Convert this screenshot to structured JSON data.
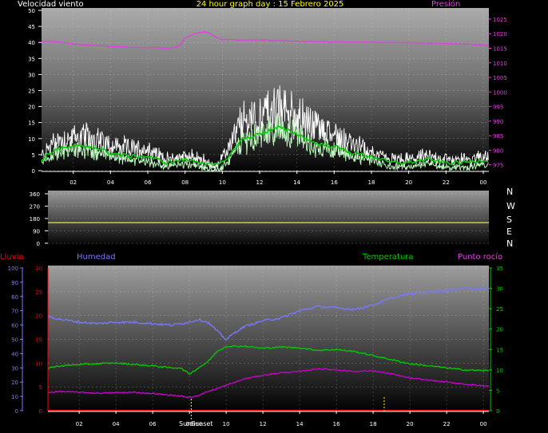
{
  "header": {
    "wind_label": "Velocidad viento",
    "title": "24 hour graph day : 15 Febrero 2025",
    "pressure_label": "Presión"
  },
  "panel_direction": {
    "cardinals": [
      "N",
      "W",
      "S",
      "E",
      "N"
    ]
  },
  "panel_bottom": {
    "rain_label": "Lluvia",
    "humidity_label": "Humedad",
    "temperature_label": "Temperatura",
    "dewpoint_label": "Punto rocío",
    "sunrise_label": "Sunrise",
    "sunset_label": "Sunset"
  },
  "colors": {
    "wind_gust": "#ffffff",
    "wind_avg": "#bfffbf",
    "wind_avg_smooth": "#00cc00",
    "pressure": "#e040e0",
    "direction": "#ffff00",
    "humidity": "#7878ff",
    "temperature": "#00cc00",
    "dewpoint": "#cc00cc",
    "rain": "#ff0000",
    "sun_marker": "#ffff00"
  },
  "chart_data": [
    {
      "type": "line",
      "title": "24 hour graph day : 15 Febrero 2025",
      "x_ticks": [
        "02",
        "04",
        "06",
        "08",
        "10",
        "12",
        "14",
        "16",
        "18",
        "20",
        "22",
        "00"
      ],
      "x_range_hours": [
        0.3,
        24.3
      ],
      "y_left": {
        "label": "Velocidad viento",
        "range": [
          0,
          50
        ],
        "ticks": [
          "0",
          "5",
          "10",
          "15",
          "20",
          "25",
          "30",
          "35",
          "40",
          "45",
          "50"
        ]
      },
      "y_right": {
        "label": "Presión",
        "range": [
          973,
          1028
        ],
        "ticks": [
          "975",
          "980",
          "985",
          "990",
          "995",
          "1000",
          "1005",
          "1010",
          "1015",
          "1020",
          "1025"
        ]
      },
      "series": [
        {
          "name": "Presión",
          "axis": "right",
          "x": [
            0.3,
            1,
            2,
            3,
            4,
            5,
            6,
            7,
            7.5,
            7.8,
            8,
            8.5,
            9,
            9.3,
            9.6,
            10,
            11,
            12,
            13,
            14,
            15,
            16,
            17,
            18,
            19,
            20,
            21,
            22,
            23,
            24.2
          ],
          "y": [
            1017.4,
            1017.2,
            1016.5,
            1016.0,
            1015.6,
            1015.4,
            1015.2,
            1015.1,
            1015.3,
            1016.5,
            1018.5,
            1020.0,
            1020.7,
            1020.2,
            1019.0,
            1018.0,
            1017.8,
            1017.9,
            1017.6,
            1017.4,
            1017.2,
            1017.2,
            1017.1,
            1017.0,
            1017.0,
            1016.9,
            1016.8,
            1016.7,
            1016.4,
            1016.0
          ]
        },
        {
          "name": "wind_gust",
          "x": [
            0.3,
            1,
            2,
            3,
            4,
            5,
            6,
            7,
            8,
            9,
            9.5,
            10,
            10.5,
            11,
            12,
            13,
            14,
            15,
            16,
            17,
            18,
            18.5,
            19,
            20,
            21,
            22,
            23,
            24.2
          ],
          "y": [
            4,
            8,
            9,
            9,
            7,
            6,
            6,
            3,
            4,
            3,
            1,
            3,
            8,
            13,
            15,
            17,
            15,
            12,
            10,
            7,
            5,
            4,
            3,
            3,
            4,
            3,
            3,
            4
          ]
        },
        {
          "name": "wind_avg",
          "x": [
            0.3,
            1,
            2,
            3,
            4,
            5,
            6,
            7,
            8,
            9,
            9.5,
            10,
            10.5,
            11,
            12,
            13,
            14,
            15,
            16,
            17,
            18,
            18.5,
            19,
            20,
            21,
            22,
            23,
            24.2
          ],
          "y": [
            2,
            5,
            6,
            6,
            4,
            3,
            3,
            1,
            2,
            1,
            0,
            1,
            4,
            8,
            10,
            12,
            10,
            7,
            6,
            4,
            3,
            2,
            1,
            1,
            2,
            1,
            1,
            2
          ]
        }
      ]
    },
    {
      "type": "line",
      "title": "",
      "y_range": [
        0,
        360
      ],
      "y_ticks": [
        "0",
        "90",
        "180",
        "270",
        "360"
      ],
      "series": [
        {
          "name": "direction",
          "x": [
            0.3,
            24.3
          ],
          "y": [
            150,
            150
          ]
        }
      ]
    },
    {
      "type": "line",
      "title": "",
      "x_ticks": [
        "02",
        "04",
        "06",
        "08",
        "10",
        "12",
        "14",
        "16",
        "18",
        "20",
        "22",
        "00"
      ],
      "y_far_left": {
        "label": "Lluvia",
        "range": [
          0,
          30
        ],
        "ticks": [
          "0",
          "5",
          "10",
          "15",
          "20",
          "25",
          "30"
        ]
      },
      "y_left": {
        "label": "Humedad",
        "range": [
          0,
          100
        ],
        "ticks": [
          "0",
          "10",
          "20",
          "30",
          "40",
          "50",
          "60",
          "70",
          "80",
          "90",
          "100"
        ]
      },
      "y_right": {
        "label": "Temperatura",
        "range": [
          0,
          35
        ],
        "ticks": [
          "0",
          "5",
          "10",
          "15",
          "20",
          "25",
          "30",
          "35"
        ]
      },
      "markers": {
        "sunrise_hour": 8.1,
        "sunset_hour": 18.6
      },
      "series": [
        {
          "name": "Humedad",
          "axis": "left",
          "x": [
            0.3,
            1,
            2,
            3,
            4,
            5,
            6,
            7,
            8,
            8.5,
            9,
            9.5,
            9.8,
            10,
            10.5,
            11,
            12,
            13,
            14,
            15,
            16,
            17,
            18,
            19,
            20,
            21,
            22,
            23,
            24.2
          ],
          "y": [
            66,
            64,
            62,
            61,
            62,
            62,
            61,
            60,
            62,
            64,
            62,
            56,
            52,
            50,
            55,
            59,
            63,
            65,
            70,
            73,
            72,
            71,
            74,
            79,
            82,
            83,
            84,
            86,
            85
          ]
        },
        {
          "name": "Temperatura",
          "axis": "right",
          "x": [
            0.3,
            1,
            2,
            3,
            4,
            5,
            6,
            7,
            7.5,
            8,
            8.5,
            9,
            9.5,
            10,
            11,
            12,
            13,
            14,
            15,
            16,
            17,
            18,
            19,
            20,
            21,
            22,
            23,
            24.2
          ],
          "y": [
            10.5,
            11,
            11.3,
            11.5,
            11.7,
            11.3,
            11,
            10.5,
            10.5,
            9.0,
            10.5,
            12,
            14.5,
            15.8,
            15.8,
            15.3,
            15.6,
            15.4,
            14.8,
            15,
            14.5,
            13.5,
            12.5,
            11.5,
            11,
            10.5,
            10,
            9.8
          ]
        },
        {
          "name": "Punto rocío",
          "axis": "right",
          "x": [
            0.3,
            1,
            2,
            3,
            4,
            5,
            6,
            7,
            7.5,
            8,
            8.5,
            9,
            9.5,
            10,
            11,
            12,
            13,
            14,
            15,
            16,
            17,
            18,
            19,
            20,
            21,
            22,
            23,
            24.2
          ],
          "y": [
            4.5,
            4.7,
            4.5,
            4.3,
            4.4,
            4.5,
            4.2,
            3.8,
            3.6,
            3.2,
            3.8,
            4.7,
            5.4,
            6.2,
            7.8,
            8.7,
            9.3,
            9.6,
            10.3,
            10.0,
            9.6,
            9.8,
            9.0,
            8.0,
            7.5,
            7.0,
            6.5,
            6.0
          ]
        },
        {
          "name": "Lluvia",
          "axis": "far_left",
          "x": [
            0.3,
            24.3
          ],
          "y": [
            0,
            0
          ]
        }
      ]
    }
  ]
}
